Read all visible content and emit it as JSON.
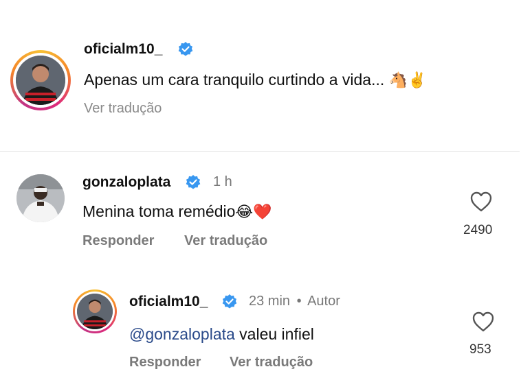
{
  "post": {
    "username": "oficialm10_",
    "caption": "Apenas um cara tranquilo curtindo a vida... ",
    "caption_emoji": "🐴✌️",
    "translate": "Ver tradução"
  },
  "comments": [
    {
      "username": "gonzaloplata",
      "time": "1 h",
      "text": "Menina toma remédio",
      "emoji": "😂❤️",
      "reply": "Responder",
      "translate": "Ver tradução",
      "likes": "2490"
    }
  ],
  "reply": {
    "username": "oficialm10_",
    "time": "23 min",
    "separator": "•",
    "author_label": "Autor",
    "mention": "@gonzaloplata",
    "text": " valeu infiel",
    "reply": "Responder",
    "translate": "Ver tradução",
    "likes": "953"
  },
  "colors": {
    "verified": "#3897f0",
    "divider": "#e6e6e6",
    "link": "#2a4a8a"
  }
}
